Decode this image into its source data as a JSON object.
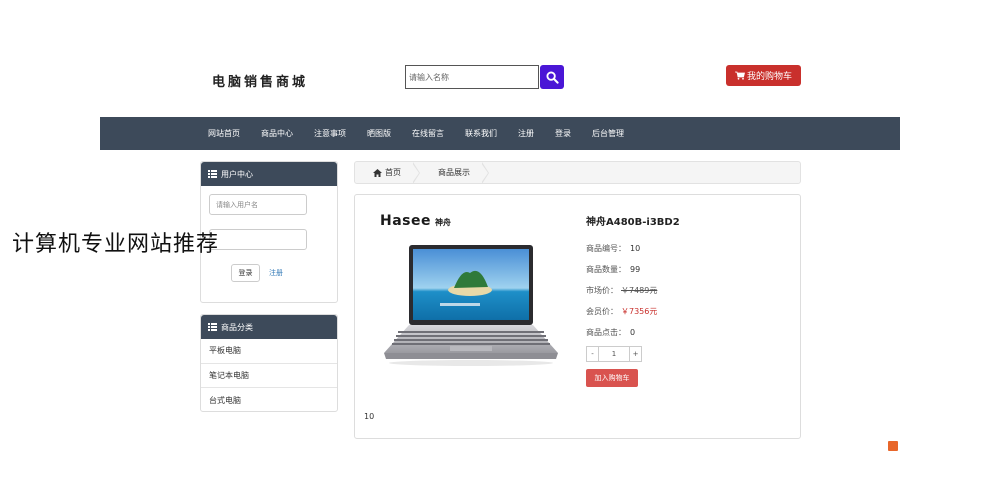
{
  "header": {
    "site_title": "电脑销售商城",
    "search_placeholder": "请输入名称",
    "cart_label": "我的购物车"
  },
  "nav": {
    "items": [
      "网站首页",
      "商品中心",
      "注意事项",
      "晒图版",
      "在线留言",
      "联系我们",
      "注册",
      "登录",
      "后台管理"
    ]
  },
  "user_center": {
    "title": "用户中心",
    "username_placeholder": "请输入用户名",
    "password_placeholder": "",
    "login_label": "登录",
    "register_label": "注册"
  },
  "categories": {
    "title": "商品分类",
    "items": [
      "平板电脑",
      "笔记本电脑",
      "台式电脑"
    ]
  },
  "breadcrumb": {
    "home": "首页",
    "current": "商品展示"
  },
  "product": {
    "brand_en": "Hasee",
    "brand_cn": "神舟",
    "title": "神舟A480B-i3BD2",
    "number_label": "商品编号：",
    "number": "10",
    "qty_label": "商品数量：",
    "qty": "99",
    "market_label": "市场价：",
    "market_price": "￥7489元",
    "member_label": "会员价：",
    "member_price": "￥7356元",
    "clicks_label": "商品点击：",
    "clicks": "0",
    "stepper_minus": "-",
    "stepper_value": "1",
    "stepper_plus": "+",
    "add_cart_label": "加入购物车",
    "footer_num": "10"
  },
  "overlay": {
    "text": "计算机专业网站推荐"
  },
  "colors": {
    "nav_bg": "#3d4a5a",
    "cart_red": "#c9302c",
    "search_btn": "#4a16d6"
  }
}
